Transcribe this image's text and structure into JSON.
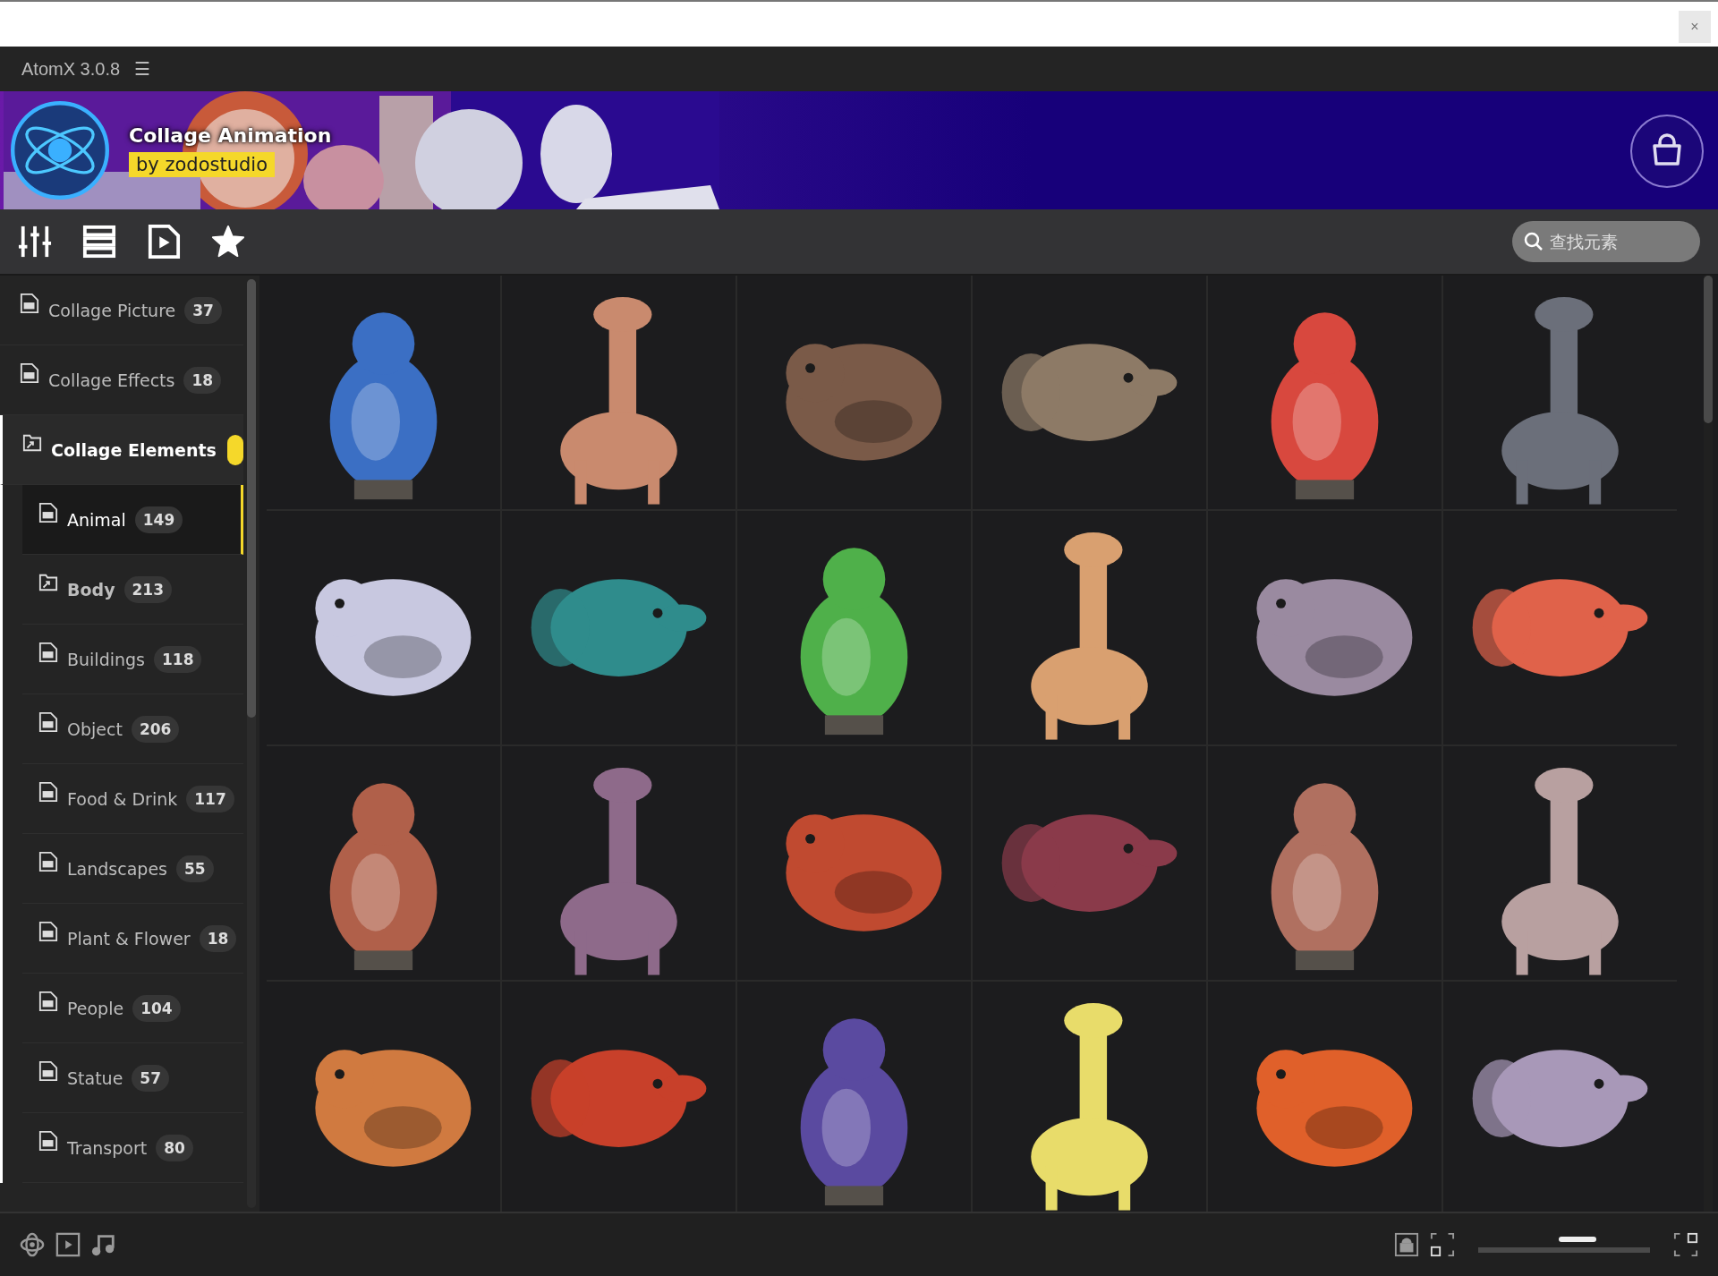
{
  "window": {
    "close_button": "×"
  },
  "app": {
    "title": "AtomX 3.0.8",
    "menu_icon": "☰"
  },
  "banner": {
    "title": "Collage Animation",
    "author": "by zodostudio"
  },
  "search": {
    "placeholder": "查找元素"
  },
  "sidebar": {
    "items": [
      {
        "label": "Collage Picture",
        "count": "37",
        "kind": "template",
        "expanded": false
      },
      {
        "label": "Collage Effects",
        "count": "18",
        "kind": "template",
        "expanded": false
      },
      {
        "label": "Collage Elements",
        "kind": "folder",
        "expanded": true,
        "badge": true,
        "children": [
          {
            "label": "Animal",
            "count": "149",
            "kind": "template",
            "selected": true
          },
          {
            "label": "Body",
            "count": "213",
            "kind": "folder",
            "selected": false
          },
          {
            "label": "Buildings",
            "count": "118",
            "kind": "template",
            "selected": false
          },
          {
            "label": "Object",
            "count": "206",
            "kind": "template",
            "selected": false
          },
          {
            "label": "Food & Drink",
            "count": "117",
            "kind": "template",
            "selected": false
          },
          {
            "label": "Landscapes",
            "count": "55",
            "kind": "template",
            "selected": false
          },
          {
            "label": "Plant & Flower",
            "count": "18",
            "kind": "template",
            "selected": false
          },
          {
            "label": "People",
            "count": "104",
            "kind": "template",
            "selected": false
          },
          {
            "label": "Statue",
            "count": "57",
            "kind": "template",
            "selected": false
          },
          {
            "label": "Transport",
            "count": "80",
            "kind": "template",
            "selected": false
          }
        ]
      }
    ]
  },
  "zoom": {
    "level": 0.58
  }
}
